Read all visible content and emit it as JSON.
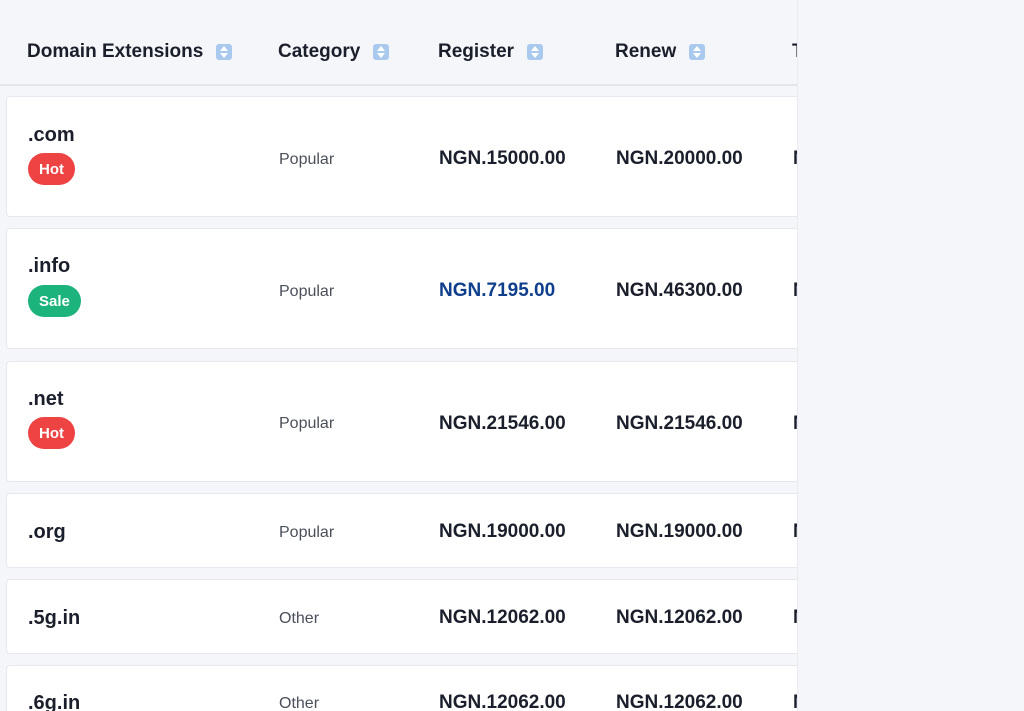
{
  "table": {
    "headers": [
      {
        "label": "Domain Extensions"
      },
      {
        "label": "Category"
      },
      {
        "label": "Register"
      },
      {
        "label": "Renew"
      },
      {
        "label": "T"
      }
    ],
    "rows": [
      {
        "tld": ".com",
        "badge": "Hot",
        "category": "Popular",
        "register": "NGN.15000.00",
        "renew": "NGN.20000.00",
        "next": "N"
      },
      {
        "tld": ".info",
        "badge": "Sale",
        "category": "Popular",
        "register": "NGN.7195.00",
        "renew": "NGN.46300.00",
        "next": "N"
      },
      {
        "tld": ".net",
        "badge": "Hot",
        "category": "Popular",
        "register": "NGN.21546.00",
        "renew": "NGN.21546.00",
        "next": "N"
      },
      {
        "tld": ".org",
        "badge": "",
        "category": "Popular",
        "register": "NGN.19000.00",
        "renew": "NGN.19000.00",
        "next": "N"
      },
      {
        "tld": ".5g.in",
        "badge": "",
        "category": "Other",
        "register": "NGN.12062.00",
        "renew": "NGN.12062.00",
        "next": "N"
      },
      {
        "tld": ".6g.in",
        "badge": "",
        "category": "Other",
        "register": "NGN.12062.00",
        "renew": "NGN.12062.00",
        "next": "N"
      }
    ]
  },
  "colors": {
    "hot": "#ee4343",
    "sale": "#1db37d",
    "sale_price": "#0f3f8c"
  }
}
